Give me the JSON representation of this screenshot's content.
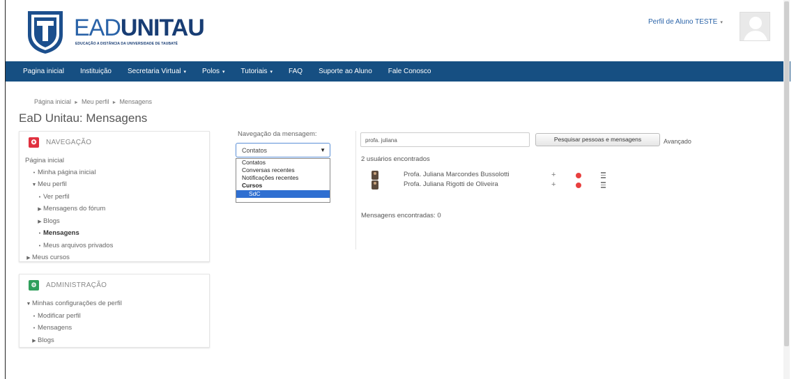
{
  "header": {
    "logo_ead": "EAD",
    "logo_unitau": "UNITAU",
    "logo_sub": "EDUCAÇÃO A DISTÂNCIA DA UNIVERSIDADE DE TAUBATÉ",
    "user_menu_label": "Perfil de Aluno TESTE",
    "user_menu_caret": "▾"
  },
  "navbar": {
    "items": [
      {
        "label": "Pagina inicial",
        "caret": ""
      },
      {
        "label": "Instituição",
        "caret": ""
      },
      {
        "label": "Secretaria Virtual",
        "caret": "▾"
      },
      {
        "label": "Polos",
        "caret": "▾"
      },
      {
        "label": "Tutoriais",
        "caret": "▾"
      },
      {
        "label": "FAQ",
        "caret": ""
      },
      {
        "label": "Suporte ao Aluno",
        "caret": ""
      },
      {
        "label": "Fale Conosco",
        "caret": ""
      }
    ]
  },
  "breadcrumb": {
    "items": [
      "Página inicial",
      "Meu perfil",
      "Mensagens"
    ],
    "separator": "►"
  },
  "page_title": "EaD Unitau: Mensagens",
  "navigation_block": {
    "title": "NAVEGAÇÃO",
    "items": [
      {
        "label": "Página inicial",
        "marker": ""
      },
      {
        "label": "Minha página inicial",
        "marker": "•"
      },
      {
        "label": "Meu perfil",
        "marker": "▼"
      },
      {
        "label": "Ver perfil",
        "marker": "•"
      },
      {
        "label": "Mensagens do fórum",
        "marker": "▶"
      },
      {
        "label": "Blogs",
        "marker": "▶"
      },
      {
        "label": "Mensagens",
        "marker": "•"
      },
      {
        "label": "Meus arquivos privados",
        "marker": "•"
      },
      {
        "label": "Meus cursos",
        "marker": "▶"
      }
    ]
  },
  "admin_block": {
    "title": "ADMINISTRAÇÃO",
    "items": [
      {
        "label": "Minhas configurações de perfil",
        "marker": "▼"
      },
      {
        "label": "Modificar perfil",
        "marker": "•"
      },
      {
        "label": "Mensagens",
        "marker": "•"
      },
      {
        "label": "Blogs",
        "marker": "▶"
      }
    ]
  },
  "message_nav": {
    "label": "Navegação da mensagem:",
    "selected": "Contatos",
    "options": [
      "Contatos",
      "Conversas recentes",
      "Notificações recentes"
    ],
    "group_label": "Cursos",
    "group_option": "SdC"
  },
  "search": {
    "value": "profa. juliana",
    "button_label": "Pesquisar pessoas e mensagens",
    "advanced_link": "Avançado",
    "users_found": "2 usuários encontrados",
    "messages_found": "Mensagens encontradas: 0",
    "results": [
      {
        "name": "Profa. Juliana Marcondes Bussolotti"
      },
      {
        "name": "Profa. Juliana Rigotti de Oliveira"
      }
    ],
    "add_icon_glyph": "+"
  },
  "colors": {
    "navbar": "#164f82",
    "brand_light": "#2a63a8",
    "brand_dark": "#183d74",
    "nav_icon": "#e0313f",
    "admin_icon": "#2f9f5b",
    "dropdown_selected": "#2f6fd1"
  }
}
